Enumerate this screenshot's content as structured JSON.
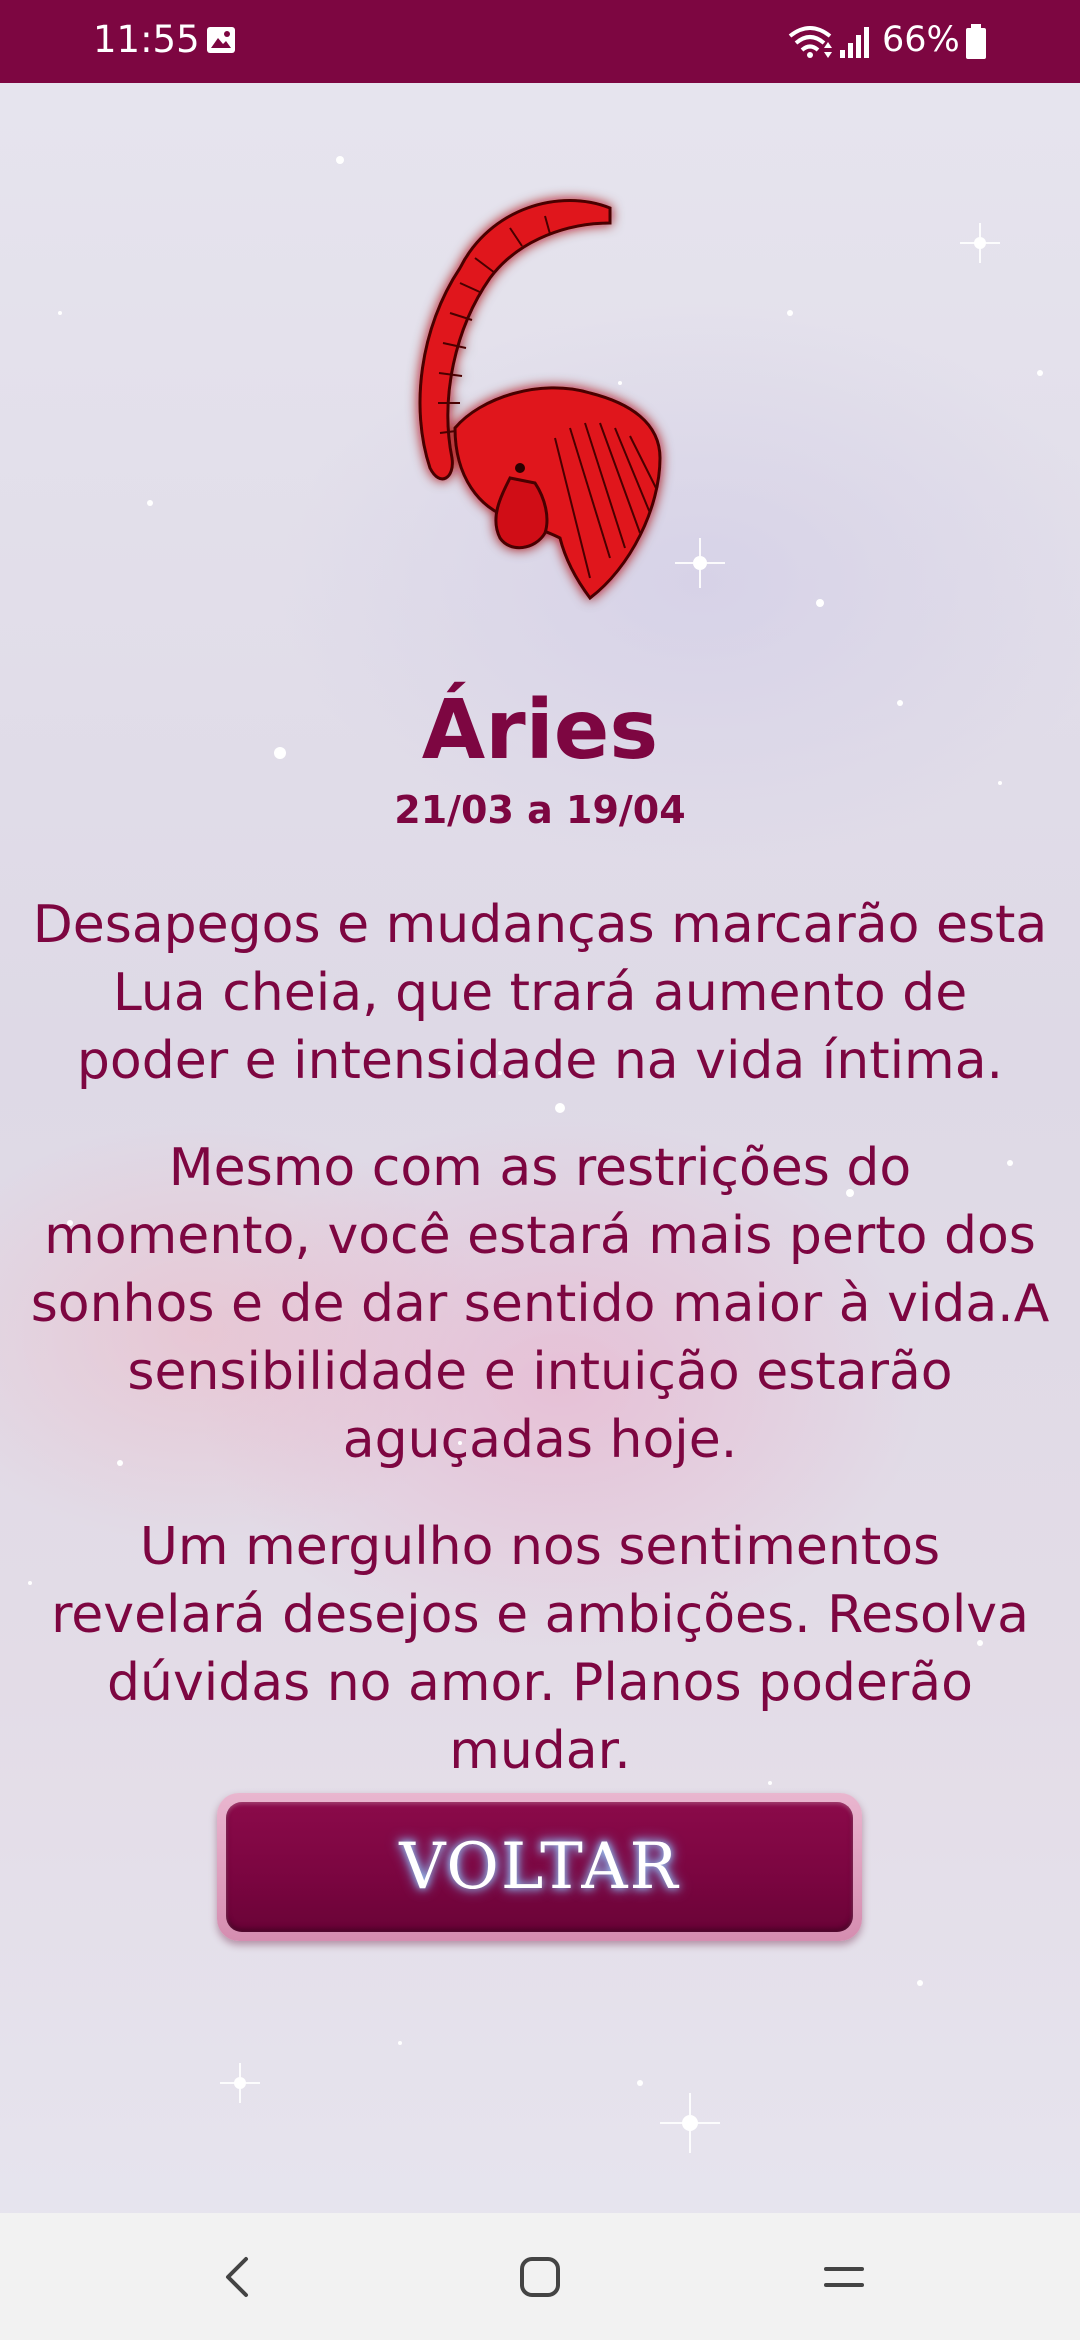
{
  "status_bar": {
    "time": "11:55",
    "battery": "66%"
  },
  "sign": {
    "name": "Áries",
    "dates": "21/03 a 19/04",
    "image": "aries-ram-head-icon"
  },
  "horoscope": {
    "paragraphs": [
      "Desapegos e mudanças marcarão esta Lua cheia, que trará aumento de poder e intensidade na vida íntima.",
      "Mesmo com as restrições do momento, você estará mais perto dos sonhos e de dar sentido maior à vida.A sensibilidade e intuição estarão aguçadas hoje.",
      "Um mergulho nos sentimentos revelará desejos e ambições. Resolva dúvidas no amor. Planos poderão mudar."
    ]
  },
  "actions": {
    "back_label": "VOLTAR"
  },
  "colors": {
    "accent": "#7d0641",
    "nav_bar": "#f2f2f2",
    "ram": "#e0161b"
  },
  "nav_bar": {
    "icons": [
      "back-icon",
      "home-icon",
      "recents-icon"
    ]
  }
}
